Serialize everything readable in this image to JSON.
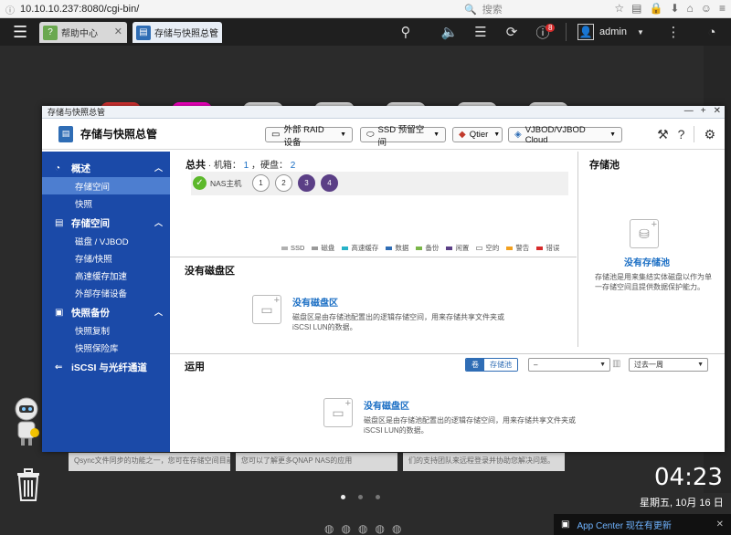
{
  "browser": {
    "url": "10.10.10.237:8080/cgi-bin/",
    "search_placeholder": "搜索"
  },
  "qts": {
    "tabs": [
      {
        "label": "帮助中心"
      },
      {
        "label": "存储与快照总管"
      }
    ],
    "notification_count": "8",
    "user": "admin"
  },
  "window": {
    "title": "存储与快照总管",
    "app_name": "存储与快照总管",
    "dropdowns": [
      "外部 RAID 设备",
      "SSD 预留空间",
      "Qtier",
      "VJBOD/VJBOD Cloud"
    ]
  },
  "sidebar": {
    "groups": [
      {
        "label": "概述",
        "items": [
          "存储空间",
          "快照"
        ]
      },
      {
        "label": "存储空间",
        "items": [
          "磁盘 / VJBOD",
          "存储/快照",
          "高速缓存加速",
          "外部存储设备"
        ]
      },
      {
        "label": "快照备份",
        "items": [
          "快照复制",
          "快照保险库"
        ]
      },
      {
        "label": "iSCSI 与光纤通道",
        "items": []
      }
    ],
    "active_item": "存储空间"
  },
  "summary": {
    "title": "总共",
    "enclosure_label": "· 机箱：",
    "enclosure_count": "1",
    "disk_label": "，硬盘：",
    "disk_count": "2",
    "nas_label": "NAS主机",
    "bays": [
      "1",
      "2",
      "3",
      "4"
    ],
    "bays_used": [
      false,
      false,
      true,
      true
    ],
    "legend": [
      {
        "label": "SSD",
        "color": "#b0b0b0"
      },
      {
        "label": "磁盘",
        "color": "#9a9a9a"
      },
      {
        "label": "高速缓存",
        "color": "#27b3c8"
      },
      {
        "label": "数据",
        "color": "#2f6db5"
      },
      {
        "label": "备份",
        "color": "#7ab648"
      },
      {
        "label": "闲置",
        "color": "#5b3f86"
      },
      {
        "label": "空的",
        "color": "#ffffff"
      },
      {
        "label": "警告",
        "color": "#f2a01f"
      },
      {
        "label": "错误",
        "color": "#d62b2b"
      }
    ]
  },
  "no_disk_area": {
    "title": "没有磁盘区",
    "empty_title": "没有磁盘区",
    "empty_desc_1": "磁盘区是由存储池配置出的逻辑存储空间，用来存储共享文件夹或",
    "empty_desc_2": "iSCSI LUN的数据。"
  },
  "storage_pool": {
    "title": "存储池",
    "empty_title": "没有存储池",
    "empty_desc": "存储池是用来集结实体磁盘以作为单一存储空间且提供数据保护能力。"
  },
  "operations": {
    "title": "运用",
    "seg_on": "卷",
    "seg_off": "存储池",
    "select_value": "–",
    "period_value": "过去一周",
    "empty_title": "没有磁盘区",
    "empty_desc_1": "磁盘区是由存储池配置出的逻辑存储空间，用来存储共享文件夹或",
    "empty_desc_2": "iSCSI LUN的数据。"
  },
  "desktop": {
    "time": "04:23",
    "date": "星期五, 10月 16 日",
    "app_center": "App Center 现在有更新",
    "bg_card_texts": [
      "Qsync文件同步的功能之一，您可在存储空间目前及控制台中找",
      "您可以了解更多QNAP NAS的应用",
      "们的支持团队来远程登录并协助您解决问题。"
    ]
  },
  "colors": {
    "sidebar_bg": "#1b4aa8",
    "sidebar_active": "#4d7ed0",
    "accent_blue": "#1a6ec4",
    "ok_green": "#5cb82b",
    "bay_used": "#5b3f86"
  }
}
